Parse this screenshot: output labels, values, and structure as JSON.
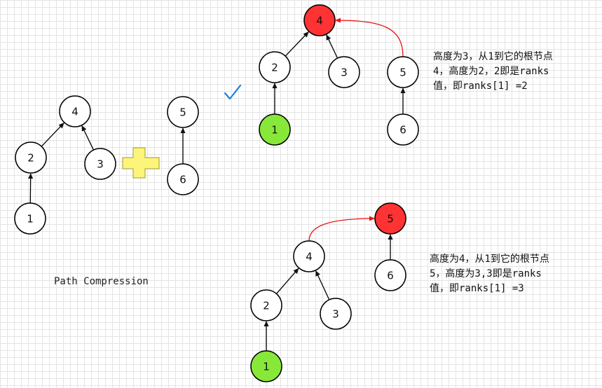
{
  "colors": {
    "default_fill": "#ffffff",
    "root_fill": "#ff3333",
    "start_fill": "#88e83a",
    "plus_fill": "#fdf57a",
    "plus_stroke": "#9a9a3a",
    "check": "#1e7fdc",
    "red_arrow": "#e81414"
  },
  "caption": "Path Compression",
  "notes": {
    "top": "高度为3，从1到它的根节点\n4，高度为2，2即是ranks\n值，即ranks[1] =2",
    "bottom": "高度为4，从1到它的根节点\n5，高度为3,3即是ranks\n值，即ranks[1] =3"
  },
  "groups": {
    "left_tree": [
      {
        "label": "4",
        "fill": "default"
      },
      {
        "label": "2",
        "fill": "default"
      },
      {
        "label": "3",
        "fill": "default"
      },
      {
        "label": "1",
        "fill": "default"
      }
    ],
    "left_pair": [
      {
        "label": "5",
        "fill": "default"
      },
      {
        "label": "6",
        "fill": "default"
      }
    ],
    "top_tree": [
      {
        "label": "4",
        "fill": "root"
      },
      {
        "label": "2",
        "fill": "default"
      },
      {
        "label": "3",
        "fill": "default"
      },
      {
        "label": "1",
        "fill": "start"
      },
      {
        "label": "5",
        "fill": "default"
      },
      {
        "label": "6",
        "fill": "default"
      }
    ],
    "bottom_tree": [
      {
        "label": "5",
        "fill": "root"
      },
      {
        "label": "4",
        "fill": "default"
      },
      {
        "label": "6",
        "fill": "default"
      },
      {
        "label": "2",
        "fill": "default"
      },
      {
        "label": "3",
        "fill": "default"
      },
      {
        "label": "1",
        "fill": "start"
      }
    ]
  },
  "symbols": {
    "plus": "plus-icon",
    "check": "check-icon"
  }
}
